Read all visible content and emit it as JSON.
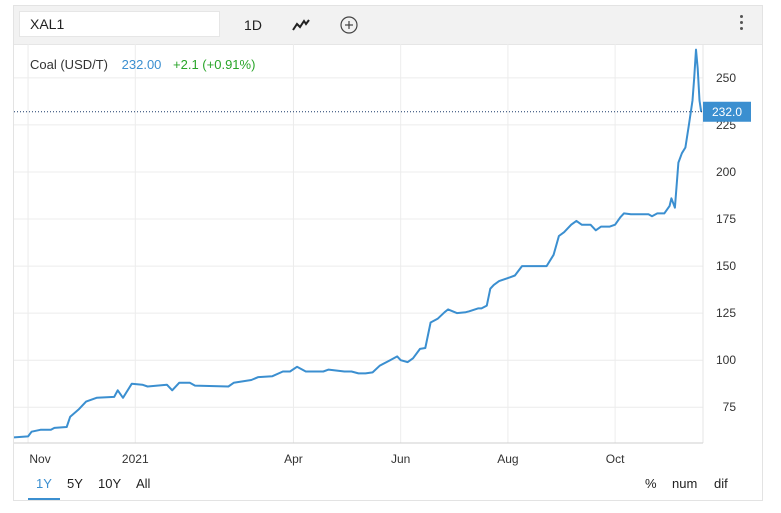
{
  "toolbar": {
    "symbol": "XAL1",
    "interval": "1D",
    "chart_type_icon": "line-chart-icon",
    "add_icon": "plus-circle-icon",
    "menu_icon": "vertical-dots-icon"
  },
  "quote": {
    "name": "Coal (USD/T)",
    "price": "232.00",
    "change": "+2.1 (+0.91%)"
  },
  "last_price_label": "232.0",
  "range_buttons": [
    "1Y",
    "5Y",
    "10Y",
    "All"
  ],
  "active_range": "1Y",
  "mode_buttons": [
    "%",
    "num",
    "dif"
  ],
  "colors": {
    "line": "#3b8fd0",
    "positive": "#2aa52a",
    "accent": "#3b8fd0"
  },
  "chart_data": {
    "type": "line",
    "title": "",
    "xlabel": "",
    "ylabel": "",
    "x_ticks": [
      {
        "label": "Nov",
        "date": "2020-11-01"
      },
      {
        "label": "2021",
        "date": "2021-01-01"
      },
      {
        "label": "Apr",
        "date": "2021-04-01"
      },
      {
        "label": "Jun",
        "date": "2021-06-01"
      },
      {
        "label": "Aug",
        "date": "2021-08-01"
      },
      {
        "label": "Oct",
        "date": "2021-10-01"
      }
    ],
    "y_ticks": [
      75,
      100,
      125,
      150,
      175,
      200,
      225,
      250
    ],
    "ylim": [
      56,
      268
    ],
    "xlim": [
      "2020-10-24",
      "2021-11-20"
    ],
    "grid": true,
    "series": [
      {
        "points": [
          [
            "2020-10-24",
            59
          ],
          [
            "2020-11-01",
            59.5
          ],
          [
            "2020-11-03",
            62
          ],
          [
            "2020-11-08",
            63
          ],
          [
            "2020-11-14",
            63
          ],
          [
            "2020-11-16",
            64
          ],
          [
            "2020-11-23",
            64.5
          ],
          [
            "2020-11-25",
            70
          ],
          [
            "2020-11-30",
            74
          ],
          [
            "2020-12-04",
            78
          ],
          [
            "2020-12-10",
            80
          ],
          [
            "2020-12-20",
            80.5
          ],
          [
            "2020-12-22",
            84
          ],
          [
            "2020-12-25",
            80
          ],
          [
            "2020-12-30",
            87.5
          ],
          [
            "2021-01-05",
            87
          ],
          [
            "2021-01-08",
            86
          ],
          [
            "2021-01-19",
            87
          ],
          [
            "2021-01-22",
            84
          ],
          [
            "2021-01-26",
            88
          ],
          [
            "2021-02-01",
            88
          ],
          [
            "2021-02-04",
            86.5
          ],
          [
            "2021-02-23",
            86
          ],
          [
            "2021-02-26",
            88
          ],
          [
            "2021-03-08",
            89.5
          ],
          [
            "2021-03-12",
            91
          ],
          [
            "2021-03-20",
            91.5
          ],
          [
            "2021-03-26",
            94
          ],
          [
            "2021-03-30",
            94
          ],
          [
            "2021-04-03",
            96.5
          ],
          [
            "2021-04-08",
            94
          ],
          [
            "2021-04-18",
            94
          ],
          [
            "2021-04-21",
            95
          ],
          [
            "2021-04-30",
            94
          ],
          [
            "2021-05-04",
            94
          ],
          [
            "2021-05-08",
            93
          ],
          [
            "2021-05-12",
            93
          ],
          [
            "2021-05-16",
            93.5
          ],
          [
            "2021-05-20",
            97
          ],
          [
            "2021-05-26",
            100
          ],
          [
            "2021-05-30",
            102
          ],
          [
            "2021-06-01",
            100
          ],
          [
            "2021-06-05",
            99
          ],
          [
            "2021-06-08",
            101
          ],
          [
            "2021-06-12",
            106
          ],
          [
            "2021-06-15",
            106.5
          ],
          [
            "2021-06-18",
            120
          ],
          [
            "2021-06-22",
            122
          ],
          [
            "2021-06-26",
            125.5
          ],
          [
            "2021-06-28",
            127
          ],
          [
            "2021-07-03",
            125
          ],
          [
            "2021-07-08",
            125.5
          ],
          [
            "2021-07-10",
            126
          ],
          [
            "2021-07-15",
            127.5
          ],
          [
            "2021-07-17",
            127.5
          ],
          [
            "2021-07-20",
            129
          ],
          [
            "2021-07-22",
            138
          ],
          [
            "2021-07-24",
            140
          ],
          [
            "2021-07-27",
            142
          ],
          [
            "2021-08-02",
            144
          ],
          [
            "2021-08-05",
            145
          ],
          [
            "2021-08-09",
            150
          ],
          [
            "2021-08-15",
            150
          ],
          [
            "2021-08-23",
            150
          ],
          [
            "2021-08-27",
            156
          ],
          [
            "2021-08-30",
            166
          ],
          [
            "2021-09-02",
            168
          ],
          [
            "2021-09-06",
            172
          ],
          [
            "2021-09-09",
            174
          ],
          [
            "2021-09-12",
            172
          ],
          [
            "2021-09-17",
            172
          ],
          [
            "2021-09-20",
            169
          ],
          [
            "2021-09-23",
            171
          ],
          [
            "2021-09-28",
            171
          ],
          [
            "2021-10-01",
            172
          ],
          [
            "2021-10-04",
            176
          ],
          [
            "2021-10-06",
            178
          ],
          [
            "2021-10-10",
            177.5
          ],
          [
            "2021-10-20",
            177.5
          ],
          [
            "2021-10-22",
            176.5
          ],
          [
            "2021-10-25",
            178
          ],
          [
            "2021-10-29",
            178
          ],
          [
            "2021-11-01",
            182
          ],
          [
            "2021-11-02",
            186
          ],
          [
            "2021-11-04",
            181
          ],
          [
            "2021-11-06",
            205
          ],
          [
            "2021-11-08",
            210
          ],
          [
            "2021-11-10",
            213
          ],
          [
            "2021-11-12",
            225
          ],
          [
            "2021-11-14",
            238
          ],
          [
            "2021-11-15",
            250
          ],
          [
            "2021-11-16",
            265
          ],
          [
            "2021-11-17",
            255
          ],
          [
            "2021-11-18",
            238
          ],
          [
            "2021-11-19",
            232
          ]
        ]
      }
    ]
  }
}
